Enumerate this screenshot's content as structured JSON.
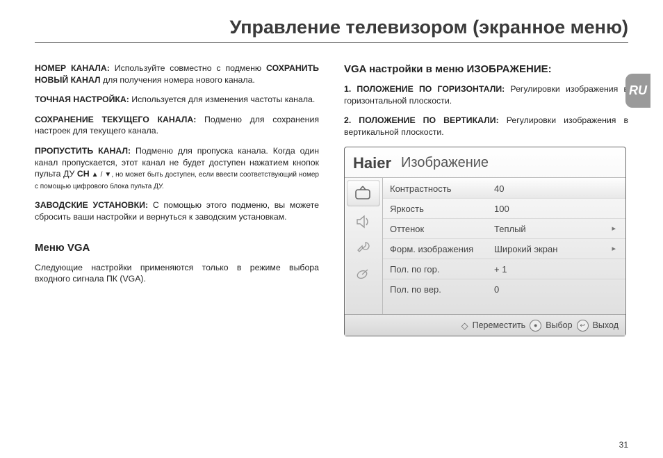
{
  "page": {
    "title": "Управление телевизором (экранное меню)",
    "lang_tab": "RU",
    "page_number": "31"
  },
  "left": {
    "p1_b1": "НОМЕР КАНАЛА:",
    "p1_t1": " Используйте совместно с подменю ",
    "p1_b2": "СОХРАНИТЬ НОВЫЙ КАНАЛ",
    "p1_t2": " для получения номера нового канала.",
    "p2_b": "ТОЧНАЯ НАСТРОЙКА:",
    "p2_t": " Используется для изменения частоты канала.",
    "p3_b": "СОХРАНЕНИЕ ТЕКУЩЕГО КАНАЛА:",
    "p3_t": " Подменю для сохранения настроек для текущего канала.",
    "p4_b": "ПРОПУСТИТЬ КАНАЛ:",
    "p4_t1": " Подменю для пропуска канала. Когда один канал пропускается, этот канал не будет доступен нажатием кнопок пульта ДУ ",
    "p4_b2": "CH",
    "p4_t2": " ▲ / ▼, но может быть доступен, если ввести соответствующий номер с помощью цифрового блока пульта ДУ.",
    "p5_b": "ЗАВОДСКИЕ УСТАНОВКИ:",
    "p5_t": " С помощью этого подменю, вы можете сбросить ваши настройки и вернуться к заводским установкам.",
    "h_vga": "Меню VGA",
    "p_vga": "Следующие настройки применяются только в режиме выбора входного сигнала ПК (VGA)."
  },
  "right": {
    "h_vga_img": "VGA настройки в меню ИЗОБРАЖЕНИЕ:",
    "li1_b": "1. ПОЛОЖЕНИЕ ПО ГОРИЗОНТАЛИ:",
    "li1_t": " Регулировки изображения в  горизонтальной плоскости.",
    "li2_b": "2. ПОЛОЖЕНИЕ ПО ВЕРТИКАЛИ:",
    "li2_t": " Регулировки изображения в вертикальной плоскости."
  },
  "osd": {
    "brand": "Haier",
    "title": "Изображение",
    "rows": [
      {
        "label": "Контрастность",
        "value": "40",
        "arrow": ""
      },
      {
        "label": "Яркость",
        "value": "100",
        "arrow": ""
      },
      {
        "label": "Оттенок",
        "value": "Теплый",
        "arrow": "▸"
      },
      {
        "label": "Форм. изображения",
        "value": "Широкий экран",
        "arrow": "▸"
      },
      {
        "label": "Пол. по гор.",
        "value": "+ 1",
        "arrow": ""
      },
      {
        "label": "Пол. по вер.",
        "value": "0",
        "arrow": ""
      }
    ],
    "footer": {
      "move": "Переместить",
      "select": "Выбор",
      "exit": "Выход"
    }
  }
}
